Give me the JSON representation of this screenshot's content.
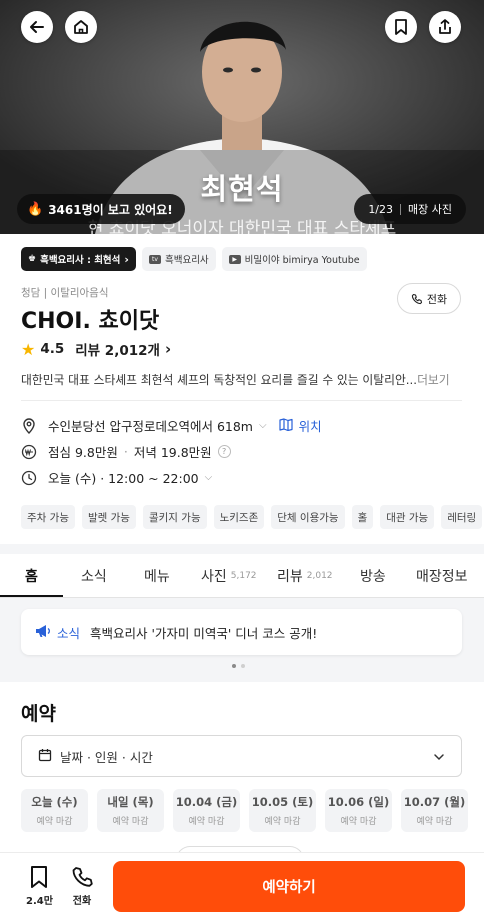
{
  "hero": {
    "caption": "최현석",
    "subcaption": "현 쵸이닷 오너이자 대한민국 대표 스타셰프",
    "viewers_text": "3461명이 보고 있어요!",
    "photo_counter": "1/23",
    "photo_label": "매장 사진"
  },
  "tags": [
    {
      "label": "흑백요리사 : 최현석",
      "style": "dark"
    },
    {
      "label": "흑백요리사",
      "style": "light"
    },
    {
      "label": "비밀이야 bimirya Youtube",
      "style": "light"
    }
  ],
  "restaurant": {
    "category": "청담 | 이탈리아음식",
    "name": "CHOI. 쵸이닷",
    "rating": "4.5",
    "review_text": "리뷰 2,012개",
    "description": "대한민국 대표 스타셰프 최현석 셰프의 독창적인 요리를 즐길 수 있는 이탈리안...",
    "more": "더보기",
    "call_label": "전화"
  },
  "info": {
    "location": "수인분당선 압구정로데오역에서 618m",
    "location_link": "위치",
    "lunch": "점심 9.8만원",
    "dinner": "저녁 19.8만원",
    "hours": "오늘 (수) · 12:00 ~ 22:00"
  },
  "amenities": [
    "주차 가능",
    "발렛 가능",
    "콜키지 가능",
    "노키즈존",
    "단체 이용가능",
    "홀",
    "대관 가능",
    "레터링"
  ],
  "tabs": [
    {
      "label": "홈",
      "count": ""
    },
    {
      "label": "소식",
      "count": ""
    },
    {
      "label": "메뉴",
      "count": ""
    },
    {
      "label": "사진",
      "count": "5,172"
    },
    {
      "label": "리뷰",
      "count": "2,012"
    },
    {
      "label": "방송",
      "count": ""
    },
    {
      "label": "매장정보",
      "count": ""
    }
  ],
  "news": {
    "tag": "소식",
    "text": "흑백요리사 '가자미 미역국' 디너 코스 공개!"
  },
  "reservation": {
    "title": "예약",
    "selector": "날짜 · 인원 · 시간",
    "dates": [
      {
        "day": "오늘 (수)",
        "status": "예약 마감"
      },
      {
        "day": "내일 (목)",
        "status": "예약 마감"
      },
      {
        "day": "10.04 (금)",
        "status": "예약 마감"
      },
      {
        "day": "10.05 (토)",
        "status": "예약 마감"
      },
      {
        "day": "10.06 (일)",
        "status": "예약 마감"
      },
      {
        "day": "10.07 (월)",
        "status": "예약 마감"
      }
    ]
  },
  "bottom": {
    "save_count": "2.4만",
    "call": "전화",
    "book": "예약하기"
  },
  "colors": {
    "accent": "#ff4d0a",
    "link": "#2961d8",
    "star": "#f8b600"
  }
}
